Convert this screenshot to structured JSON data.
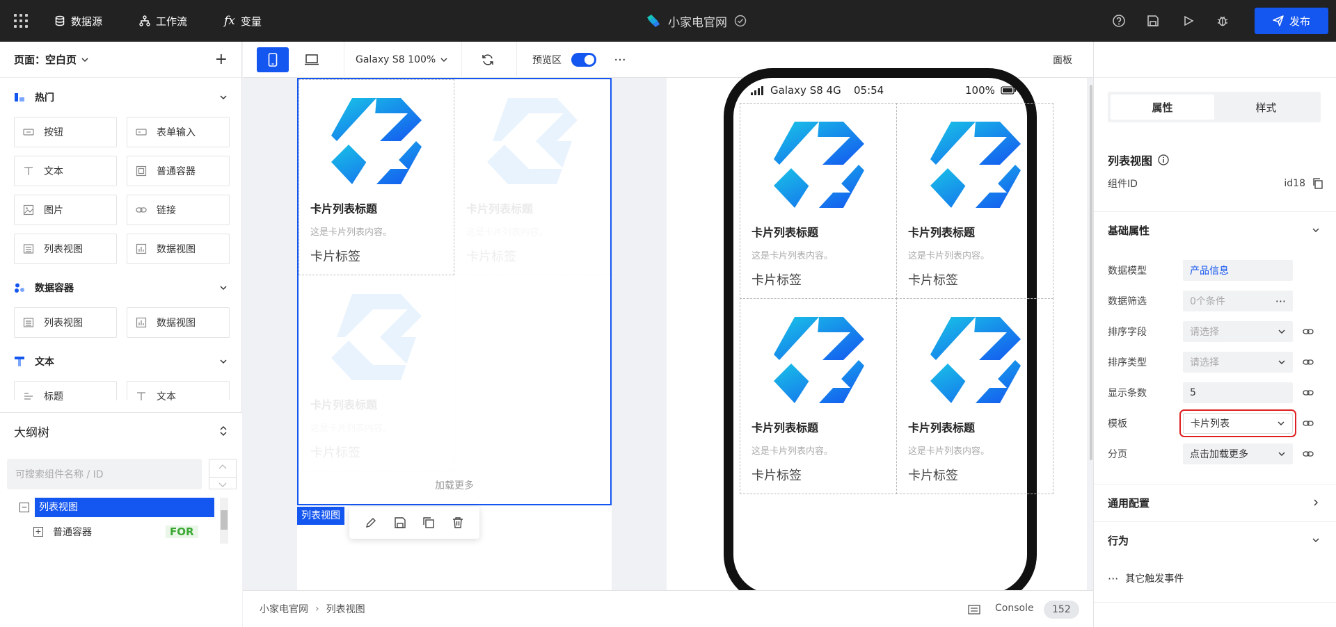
{
  "topbar": {
    "nav": [
      {
        "label": "数据源",
        "icon": "database-icon"
      },
      {
        "label": "工作流",
        "icon": "workflow-icon"
      },
      {
        "label": "变量",
        "icon": "fx-icon"
      }
    ],
    "app_title": "小家电官网",
    "publish_label": "发布"
  },
  "left": {
    "page_label": "页面：空白页",
    "categories": [
      {
        "title": "热门",
        "items": [
          "按钮",
          "表单输入",
          "文本",
          "普通容器",
          "图片",
          "链接",
          "列表视图",
          "数据视图"
        ]
      },
      {
        "title": "数据容器",
        "items": [
          "列表视图",
          "数据视图"
        ]
      },
      {
        "title": "文本",
        "items": [
          "标题",
          "文本"
        ]
      }
    ]
  },
  "outline": {
    "title": "大纲树",
    "search_placeholder": "可搜索组件名称 / ID",
    "nodes": [
      {
        "label": "列表视图",
        "selected": true
      },
      {
        "label": "普通容器",
        "badge": "FOR"
      }
    ]
  },
  "toolbar": {
    "device": "Galaxy S8 100%",
    "preview_label": "预览区",
    "preview_on": true,
    "more": "···",
    "panel_label": "面板"
  },
  "editor": {
    "card_title": "卡片列表标题",
    "card_desc": "这是卡片列表内容。",
    "card_tag": "卡片标签",
    "load_more": "加载更多",
    "selected_tag": "列表视图"
  },
  "phone": {
    "status_left": "Galaxy S8  4G",
    "status_time": "05:54",
    "status_battery": "100%",
    "cards": [
      {
        "title": "卡片列表标题",
        "desc": "这是卡片列表内容。",
        "tag": "卡片标签"
      },
      {
        "title": "卡片列表标题",
        "desc": "这是卡片列表内容。",
        "tag": "卡片标签"
      },
      {
        "title": "卡片列表标题",
        "desc": "这是卡片列表内容。",
        "tag": "卡片标签"
      },
      {
        "title": "卡片列表标题",
        "desc": "这是卡片列表内容。",
        "tag": "卡片标签"
      }
    ]
  },
  "bottombar": {
    "crumbs": [
      "小家电官网",
      "列表视图"
    ],
    "console_label": "Console",
    "console_count": "152"
  },
  "right": {
    "tabs": [
      "属性",
      "样式"
    ],
    "component_name": "列表视图",
    "component_id_label": "组件ID",
    "component_id": "id18",
    "basic_section": "基础属性",
    "props": [
      {
        "label": "数据模型",
        "value": "产品信息"
      },
      {
        "label": "数据筛选",
        "value": "0个条件"
      },
      {
        "label": "排序字段",
        "value": "请选择"
      },
      {
        "label": "排序类型",
        "value": "请选择"
      },
      {
        "label": "显示条数",
        "value": "5"
      },
      {
        "label": "模板",
        "value": "卡片列表"
      },
      {
        "label": "分页",
        "value": "点击加载更多"
      }
    ],
    "general_section": "通用配置",
    "behavior_section": "行为",
    "other_events": "其它触发事件"
  },
  "colors": {
    "accent": "#1456f0",
    "highlight": "#e02020",
    "topbar": "#222222"
  }
}
